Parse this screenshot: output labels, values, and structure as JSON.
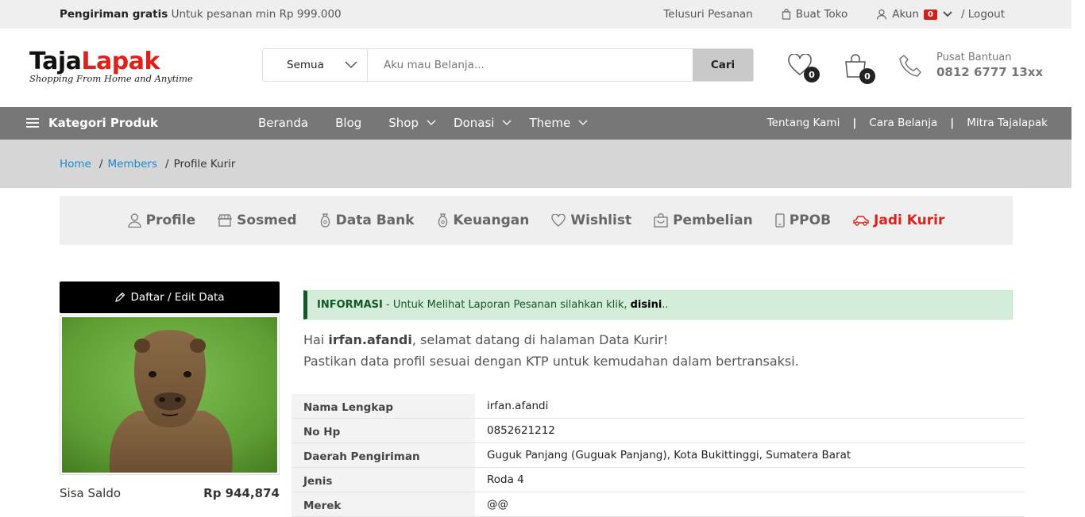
{
  "topbar": {
    "promo_bold": "Pengiriman gratis",
    "promo_text": "Untuk pesanan min Rp 999.000",
    "track_orders": "Telusuri Pesanan",
    "create_store": "Buat Toko",
    "account": "Akun",
    "account_badge": "0",
    "logout": "/ Logout"
  },
  "header": {
    "logo_part1": "Taja",
    "logo_part2": "Lapak",
    "logo_tagline": "Shopping From Home and Anytime",
    "search_category": "Semua",
    "search_placeholder": "Aku mau Belanja...",
    "search_button": "Cari",
    "wishlist_count": "0",
    "cart_count": "0",
    "help_label": "Pusat Bantuan",
    "help_phone": "0812 6777 13xx"
  },
  "nav": {
    "category": "Kategori Produk",
    "menu": [
      "Beranda",
      "Blog",
      "Shop",
      "Donasi",
      "Theme"
    ],
    "right": [
      "Tentang Kami",
      "Cara Belanja",
      "Mitra Tajalapak"
    ]
  },
  "breadcrumb": {
    "home": "Home",
    "members": "Members",
    "current": "Profile Kurir"
  },
  "tabs": [
    "Profile",
    "Sosmed",
    "Data Bank",
    "Keuangan",
    "Wishlist",
    "Pembelian",
    "PPOB",
    "Jadi Kurir"
  ],
  "sidebar": {
    "edit_button": "Daftar / Edit Data",
    "saldo_label": "Sisa Saldo",
    "saldo_value": "Rp 944,874"
  },
  "alert": {
    "label": "INFORMASI",
    "text": " - Untuk Melihat Laporan Pesanan silahkan klik, ",
    "link": "disini",
    "end": ".."
  },
  "welcome": {
    "prefix": "Hai ",
    "username": "irfan.afandi",
    "suffix": ", selamat datang di halaman Data Kurir!",
    "line2": "Pastikan data profil sesuai dengan KTP untuk kemudahan dalam bertransaksi."
  },
  "details": [
    {
      "label": "Nama Lengkap",
      "value": "irfan.afandi"
    },
    {
      "label": "No Hp",
      "value": "0852621212"
    },
    {
      "label": "Daerah Pengiriman",
      "value": "Guguk Panjang (Guguak Panjang), Kota Bukittinggi, Sumatera Barat"
    },
    {
      "label": "Jenis",
      "value": "Roda 4"
    },
    {
      "label": "Merek",
      "value": "@@"
    }
  ],
  "colors": {
    "accent_red": "#e0201a",
    "nav_gray": "#777777",
    "link_blue": "#1a8bcc",
    "alert_green": "#155724"
  }
}
